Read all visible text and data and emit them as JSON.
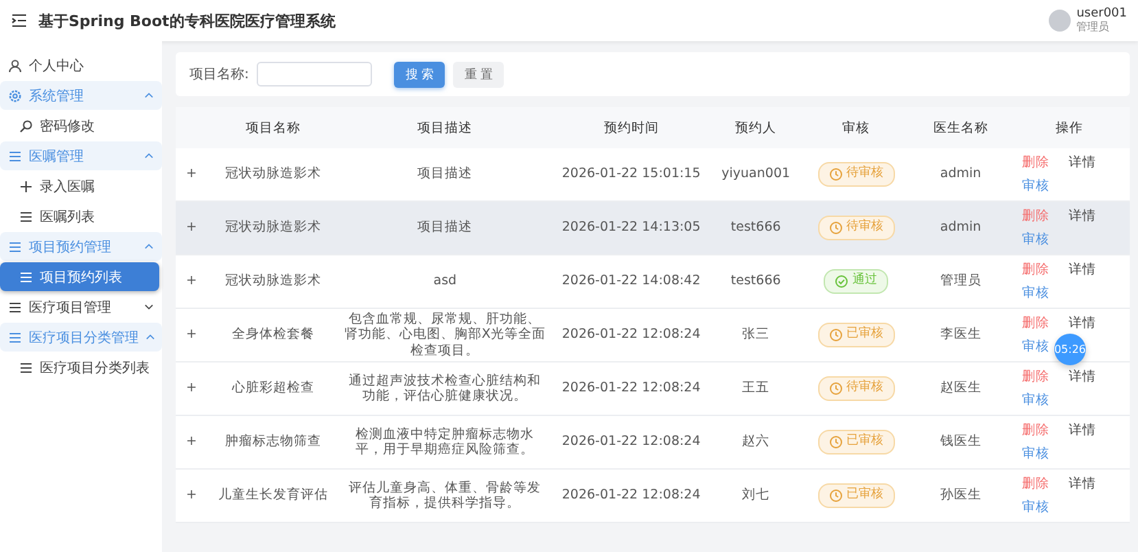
{
  "header": {
    "title": "基于Spring Boot的专科医院医疗管理系统",
    "user": {
      "name": "user001",
      "role": "管理员"
    }
  },
  "sidebar": {
    "items": [
      {
        "label": "个人中心",
        "kind": "user",
        "selected": false
      },
      {
        "label": "系统管理",
        "kind": "gear",
        "expanded": true,
        "selected": false,
        "children": [
          {
            "label": "密码修改",
            "kind": "search",
            "selected": false
          }
        ]
      },
      {
        "label": "医嘱管理",
        "kind": "list",
        "expanded": true,
        "selected": false,
        "children": [
          {
            "label": "录入医嘱",
            "kind": "plus",
            "selected": false
          },
          {
            "label": "医嘱列表",
            "kind": "list",
            "selected": false
          }
        ]
      },
      {
        "label": "项目预约管理",
        "kind": "list",
        "expanded": true,
        "selected": false,
        "children": [
          {
            "label": "项目预约列表",
            "kind": "list",
            "selected": true
          }
        ]
      },
      {
        "label": "医疗项目管理",
        "kind": "list",
        "expanded": false,
        "selected": false
      },
      {
        "label": "医疗项目分类管理",
        "kind": "list",
        "expanded": true,
        "selected": false,
        "children": [
          {
            "label": "医疗项目分类列表",
            "kind": "list",
            "selected": false
          }
        ]
      }
    ]
  },
  "search": {
    "label": "项目名称:",
    "buttons": [
      {
        "label": "搜 索",
        "kind": "primary"
      },
      {
        "label": "重 置",
        "kind": "default"
      }
    ]
  },
  "table": {
    "columns": [
      "项目名称",
      "项目描述",
      "预约时间",
      "预约人",
      "审核",
      "医生名称",
      "操作"
    ],
    "rows": [
      {
        "expand": "+",
        "name": "冠状动脉造影术",
        "description": "项目描述",
        "time": "2026-01-22 15:01:15",
        "person": "yiyuan001",
        "status": {
          "label": "待审核",
          "kind": "pending"
        },
        "doctor": "admin",
        "actions": [
          "删除",
          "详情",
          "审核"
        ],
        "selected": false
      },
      {
        "expand": "+",
        "name": "冠状动脉造影术",
        "description": "项目描述",
        "time": "2026-01-22 14:13:05",
        "person": "test666",
        "status": {
          "label": "待审核",
          "kind": "pending"
        },
        "doctor": "admin",
        "actions": [
          "删除",
          "详情",
          "审核"
        ],
        "selected": true
      },
      {
        "expand": "+",
        "name": "冠状动脉造影术",
        "description": "asd",
        "time": "2026-01-22 14:08:42",
        "person": "test666",
        "status": {
          "label": "通过",
          "kind": "success"
        },
        "doctor": "管理员",
        "actions": [
          "删除",
          "详情",
          "审核"
        ],
        "selected": false
      },
      {
        "expand": "+",
        "name": "全身体检套餐",
        "description": "包含血常规、尿常规、肝功能、肾功能、心电图、胸部X光等全面检查项目。",
        "time": "2026-01-22 12:08:24",
        "person": "张三",
        "status": {
          "label": "已审核",
          "kind": "pending"
        },
        "doctor": "李医生",
        "actions": [
          "删除",
          "详情",
          "审核"
        ],
        "selected": false
      },
      {
        "expand": "+",
        "name": "心脏彩超检查",
        "description": "通过超声波技术检查心脏结构和功能，评估心脏健康状况。",
        "time": "2026-01-22 12:08:24",
        "person": "王五",
        "status": {
          "label": "待审核",
          "kind": "pending"
        },
        "doctor": "赵医生",
        "actions": [
          "删除",
          "详情",
          "审核"
        ],
        "selected": false
      },
      {
        "expand": "+",
        "name": "肿瘤标志物筛查",
        "description": "检测血液中特定肿瘤标志物水平，用于早期癌症风险筛查。",
        "time": "2026-01-22 12:08:24",
        "person": "赵六",
        "status": {
          "label": "已审核",
          "kind": "pending"
        },
        "doctor": "钱医生",
        "actions": [
          "删除",
          "详情",
          "审核"
        ],
        "selected": false
      },
      {
        "expand": "+",
        "name": "儿童生长发育评估",
        "description": "评估儿童身高、体重、骨龄等发育指标，提供科学指导。",
        "time": "2026-01-22 12:08:24",
        "person": "刘七",
        "status": {
          "label": "已审核",
          "kind": "pending"
        },
        "doctor": "孙医生",
        "actions": [
          "删除",
          "详情",
          "审核"
        ],
        "selected": false
      }
    ]
  },
  "timer_badge": "05:26"
}
